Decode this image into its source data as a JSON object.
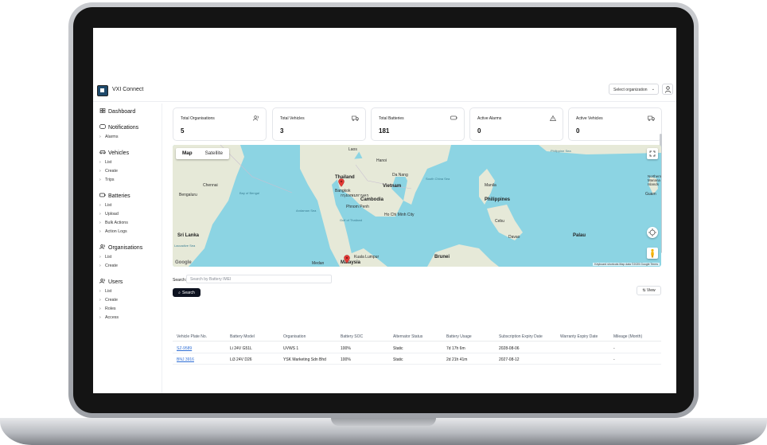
{
  "app": {
    "title": "VXI Connect"
  },
  "header": {
    "org_select_label": "Select organization"
  },
  "sidebar": {
    "sections": [
      {
        "label": "Dashboard",
        "items": []
      },
      {
        "label": "Notifications",
        "items": [
          "Alarms"
        ]
      },
      {
        "label": "Vehicles",
        "items": [
          "List",
          "Create",
          "Trips"
        ]
      },
      {
        "label": "Batteries",
        "items": [
          "List",
          "Upload",
          "Bulk Actions",
          "Action Logs"
        ]
      },
      {
        "label": "Organisations",
        "items": [
          "List",
          "Create"
        ]
      },
      {
        "label": "Users",
        "items": [
          "List",
          "Create",
          "Roles",
          "Access"
        ]
      }
    ]
  },
  "stats": [
    {
      "label": "Total Organisations",
      "value": "5",
      "icon": "users-icon"
    },
    {
      "label": "Total Vehicles",
      "value": "3",
      "icon": "truck-icon"
    },
    {
      "label": "Total Batteries",
      "value": "181",
      "icon": "battery-icon"
    },
    {
      "label": "Active Alarms",
      "value": "0",
      "icon": "alert-triangle-icon"
    },
    {
      "label": "Active Vehicles",
      "value": "0",
      "icon": "truck-icon"
    }
  ],
  "map": {
    "tabs": [
      "Map",
      "Satellite"
    ],
    "labels": {
      "laos": "Laos",
      "thailand": "Thailand",
      "bangkok": "Bangkok",
      "bangkok_thai": "กรุงเทพมหานคร",
      "vietnam": "Vietnam",
      "cambodia": "Cambodia",
      "phnom_penh": "Phnom Penh",
      "ho_chi_minh": "Ho Chi Minh City",
      "philippines": "Philippines",
      "manila": "Manila",
      "bay_of_bengal": "Bay of Bengal",
      "andaman_sea": "Andaman Sea",
      "gulf_of_thailand": "Gulf of Thailand",
      "south_china_sea": "South China Sea",
      "sri_lanka": "Sri Lanka",
      "malaysia": "Malaysia",
      "brunei": "Brunei",
      "palau": "Palau",
      "medan": "Medan",
      "bengaluru": "Bengaluru",
      "chennai": "Chennai",
      "hanoi": "Hanoi",
      "da_nang": "Da Nang",
      "davao": "Davao",
      "northern_mariana": "Northern Mariana Islands",
      "guam": "Guam",
      "philippine_sea": "Philippine Sea",
      "laccadive_sea": "Laccadive Sea",
      "cebu": "Cebu",
      "kuala_lumpur": "Kuala Lumpur"
    },
    "attribution": "Keyboard shortcuts  Map data ©2025 Google  Terms",
    "google": "Google"
  },
  "search": {
    "label": "Search:",
    "placeholder": "Search by Battery IMEI",
    "button": "Search"
  },
  "view_button": "View",
  "table": {
    "headers": [
      "Vehicle Plate No.",
      "Battery Model",
      "Organisation",
      "Battery SOC",
      "Alternator Status",
      "Battery Usage",
      "Subscription Expiry Date",
      "Warranty Expiry Date",
      "Mileage (Month)"
    ],
    "rows": [
      [
        "SZ-9589",
        "Li 24V G51L",
        "UVWS 1",
        "100%",
        "Static",
        "7d 17h 6m",
        "2028-08-06",
        "",
        "-"
      ],
      [
        "BNJ 3916",
        "Li3 24V D26",
        "YSK Marketing Sdn Bhd",
        "100%",
        "Static",
        "2d 21h 41m",
        "2027-08-12",
        "",
        "-"
      ]
    ]
  },
  "colors": {
    "primary": "#0d1220",
    "map_water": "#8cd4e3",
    "map_land": "#e8eadc",
    "link": "#2f6fd6",
    "pin": "#e53935"
  }
}
